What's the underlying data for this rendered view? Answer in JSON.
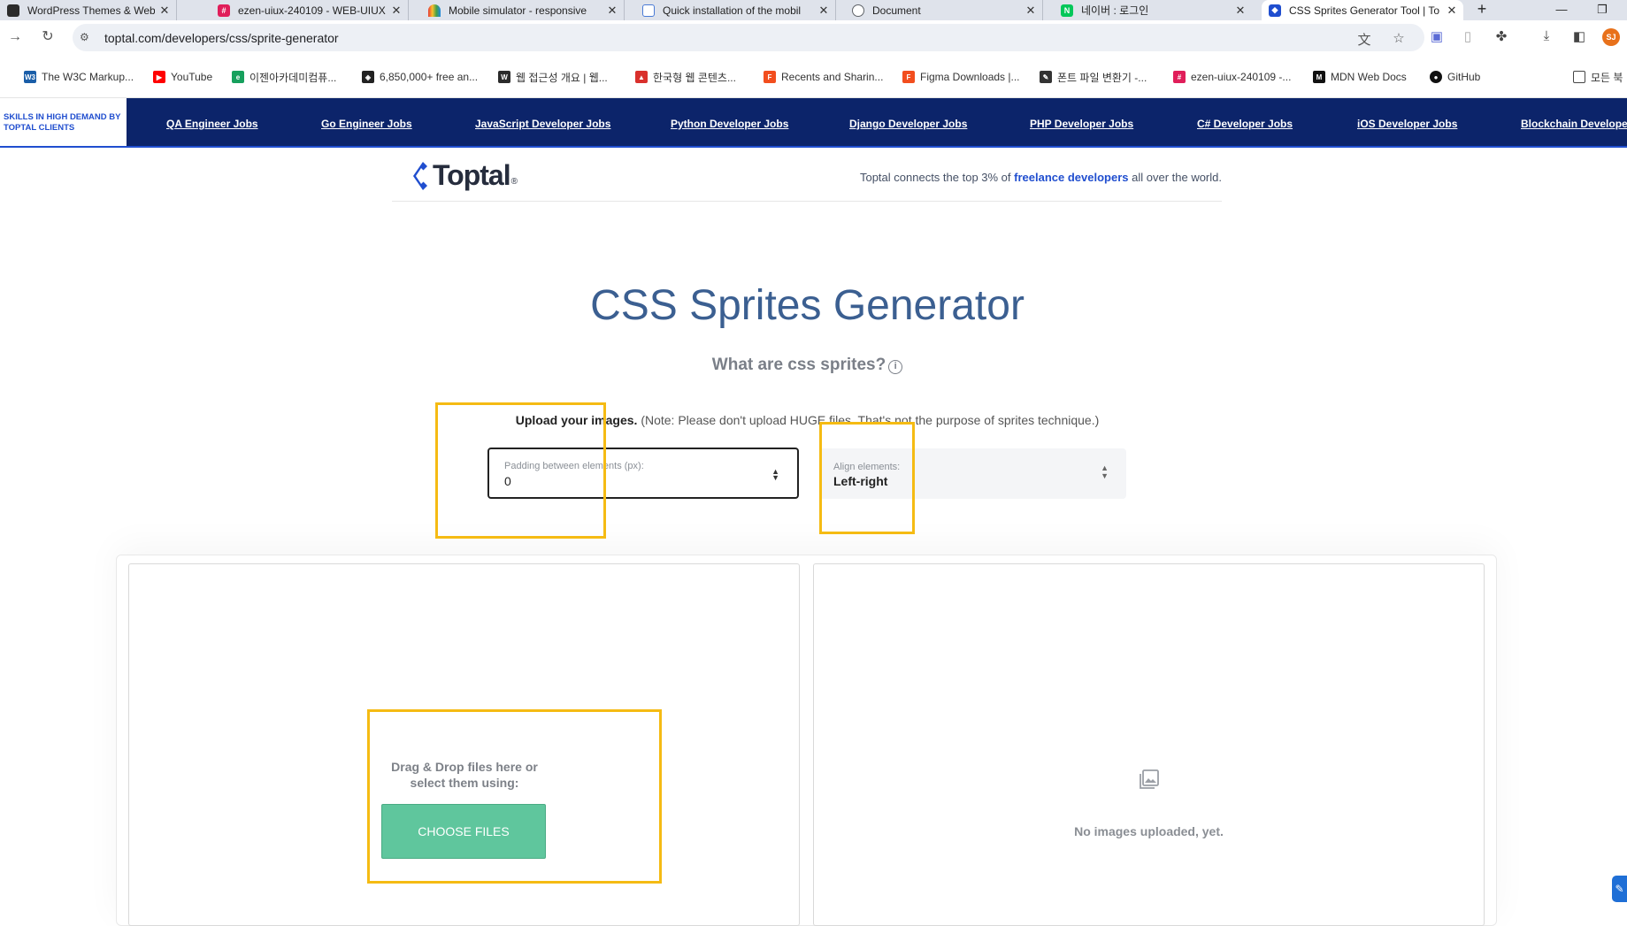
{
  "browser": {
    "tabs": [
      {
        "title": "WordPress Themes & Website",
        "favicon": "wordpress-icon",
        "color": "#2b2b2b"
      },
      {
        "title": "ezen-uiux-240109 - WEB-UIUX",
        "favicon": "slack-icon",
        "color": "#e01e5a"
      },
      {
        "title": "Mobile simulator - responsive",
        "favicon": "rainbow-icon",
        "color": "#f29900"
      },
      {
        "title": "Quick installation of the mobil",
        "favicon": "document-icon",
        "color": "#4a7bd6"
      },
      {
        "title": "Document",
        "favicon": "globe-icon",
        "color": "#5f6368"
      },
      {
        "title": "네이버 : 로그인",
        "favicon": "naver-icon",
        "color": "#03c75a"
      },
      {
        "title": "CSS Sprites Generator Tool | To",
        "favicon": "toptal-icon",
        "color": "#204ecf"
      }
    ],
    "new_tab": "+",
    "url": "toptal.com/developers/css/sprite-generator",
    "profile_initials": "SJ",
    "bookmarks": [
      {
        "label": "The W3C Markup...",
        "icon": "w3c-icon",
        "color": "#1a5ea8"
      },
      {
        "label": "YouTube",
        "icon": "youtube-icon",
        "color": "#ff0000"
      },
      {
        "label": "이젠아카데미컴퓨...",
        "icon": "ezen-icon",
        "color": "#17a05d"
      },
      {
        "label": "6,850,000+ free an...",
        "icon": "free-icon",
        "color": "#222222"
      },
      {
        "label": "웹 접근성 개요 | 웹...",
        "icon": "web-icon",
        "color": "#2b2b2b"
      },
      {
        "label": "한국형 웹 콘텐츠...",
        "icon": "pdf-icon",
        "color": "#d9302c"
      },
      {
        "label": "Recents and Sharin...",
        "icon": "figma-icon",
        "color": "#f24e1e"
      },
      {
        "label": "Figma Downloads |...",
        "icon": "figma-icon",
        "color": "#f24e1e"
      },
      {
        "label": "폰트 파일 변환기 -...",
        "icon": "wrench-icon",
        "color": "#333333"
      },
      {
        "label": "ezen-uiux-240109 -...",
        "icon": "slack-icon",
        "color": "#e01e5a"
      },
      {
        "label": "MDN Web Docs",
        "icon": "mdn-icon",
        "color": "#111111"
      },
      {
        "label": "GitHub",
        "icon": "github-icon",
        "color": "#111111"
      },
      {
        "label": "모든 북",
        "icon": "folder-icon",
        "color": "#444444"
      }
    ]
  },
  "site_nav": {
    "skills_label": "Skills in high demand by Toptal clients",
    "jobs": [
      "QA Engineer Jobs",
      "Go Engineer Jobs",
      "JavaScript Developer Jobs",
      "Python Developer Jobs",
      "Django Developer Jobs",
      "PHP Developer Jobs",
      "C# Developer Jobs",
      "iOS Developer Jobs",
      "Blockchain Developer Jobs"
    ]
  },
  "header": {
    "logo_text": "Toptal",
    "tagline_before": "Toptal connects the top 3% of ",
    "tagline_link": "freelance developers",
    "tagline_after": " all over the world."
  },
  "main": {
    "title": "CSS Sprites Generator",
    "what_are": "What are css sprites?",
    "upload_bold": "Upload your images.",
    "upload_note": " (Note: Please don't upload HUGE files. That's not the purpose of sprites technique.)",
    "padding_label": "Padding between elements (px):",
    "padding_value": "0",
    "align_label": "Align elements:",
    "align_value": "Left-right",
    "drop_text": "Drag & Drop files here or select them using:",
    "choose_files": "CHOOSE FILES",
    "no_images": "No images uploaded, yet."
  },
  "colors": {
    "nav_bg": "#0c246a",
    "brand_blue": "#204ecf",
    "title_blue": "#3b5f91",
    "button_green": "#5fc69d",
    "highlight": "#f5bb13"
  }
}
